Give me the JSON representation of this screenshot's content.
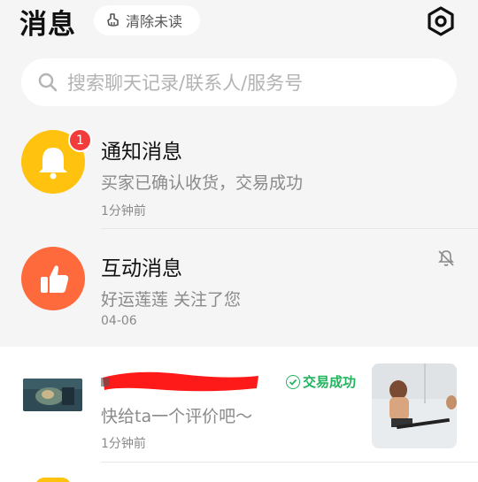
{
  "header": {
    "title": "消息",
    "clear_unread_label": "清除未读"
  },
  "search": {
    "placeholder": "搜索聊天记录/联系人/服务号"
  },
  "conversations": [
    {
      "name": "通知消息",
      "preview": "买家已确认收货，交易成功",
      "time": "1分钟前",
      "badge": "1",
      "icon": "bell-icon",
      "color": "#ffc20e"
    },
    {
      "name": "互动消息",
      "preview": "好运莲莲 关注了您",
      "time": "04-06",
      "icon": "thumbs-up-icon",
      "color": "#ff6a3d",
      "muted": true
    },
    {
      "preview": "快给ta一个评价吧～",
      "time": "1分钟前",
      "status": "交易成功"
    }
  ],
  "colors": {
    "accent_green": "#22b35e",
    "badge_red": "#f23c3c",
    "background": "#f5f5f5"
  }
}
